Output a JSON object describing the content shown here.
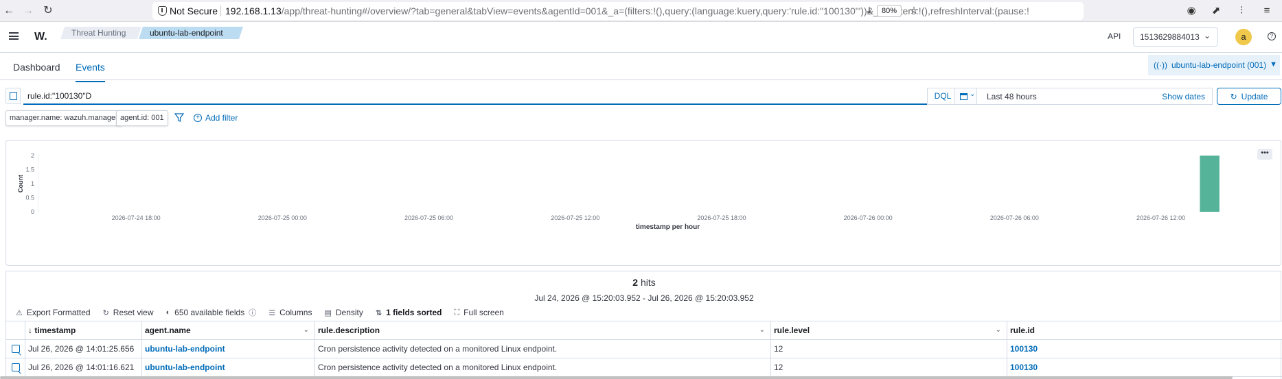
{
  "browser": {
    "security_label": "Not Secure",
    "url_host": "192.168.1.13",
    "url_path": "/app/threat-hunting#/overview/?tab=general&tabView=events&agentId=001&_a=(filters:!(),query:(language:kuery,query:'rule.id:\"100130\"'))&_g=(filters:!(),refreshInterval:(pause:!t",
    "zoom": "80%"
  },
  "header": {
    "logo": "W.",
    "breadcrumbs": [
      "Threat Hunting",
      "ubuntu-lab-endpoint"
    ],
    "api_label": "API",
    "tenant": "1513629884013",
    "avatar_initial": "a"
  },
  "tabs": {
    "items": [
      "Dashboard",
      "Events"
    ],
    "active": "Events",
    "agent_pill": "ubuntu-lab-endpoint (001)"
  },
  "query": {
    "value": "rule.id:\"100130\"D",
    "language": "DQL",
    "date_range": "Last 48 hours",
    "show_dates": "Show dates",
    "update": "Update"
  },
  "filters": {
    "pills": [
      "manager.name: wazuh.manager",
      "agent.id: 001"
    ],
    "add_filter": "Add filter"
  },
  "chart_data": {
    "type": "bar",
    "xlabel": "timestamp per hour",
    "ylabel": "Count",
    "yticks": [
      0,
      0.5,
      1,
      1.5,
      2
    ],
    "ylim": [
      0,
      2
    ],
    "xticks": [
      "2026-07-24 18:00",
      "2026-07-25 00:00",
      "2026-07-25 06:00",
      "2026-07-25 12:00",
      "2026-07-25 18:00",
      "2026-07-26 00:00",
      "2026-07-26 06:00",
      "2026-07-26 12:00"
    ],
    "x": [
      "2026-07-26 14:00"
    ],
    "values": [
      2
    ],
    "bar_color": "#54b399",
    "grid": false
  },
  "results": {
    "hit_count": "2",
    "hit_label": "hits",
    "range": "Jul 24, 2026 @ 15:20:03.952 - Jul 26, 2026 @ 15:20:03.952",
    "toolbar": {
      "export": "Export Formatted",
      "reset": "Reset view",
      "fields": "650 available fields",
      "columns": "Columns",
      "density": "Density",
      "sorted": "1 fields sorted",
      "fullscreen": "Full screen"
    },
    "columns": [
      "timestamp",
      "agent.name",
      "rule.description",
      "rule.level",
      "rule.id"
    ],
    "rows": [
      [
        "Jul 26, 2026 @ 14:01:25.656",
        "ubuntu-lab-endpoint",
        "Cron persistence activity detected on a monitored Linux endpoint.",
        "12",
        "100130"
      ],
      [
        "Jul 26, 2026 @ 14:01:16.621",
        "ubuntu-lab-endpoint",
        "Cron persistence activity detected on a monitored Linux endpoint.",
        "12",
        "100130"
      ]
    ]
  }
}
